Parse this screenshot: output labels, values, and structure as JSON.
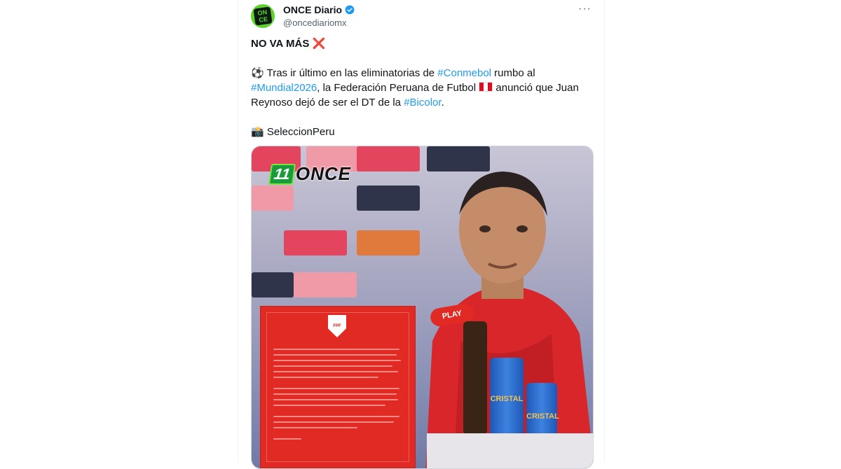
{
  "tweet": {
    "author": "ONCE Diario",
    "handle": "@oncediariomx",
    "avatar_text": "ON\nCE",
    "more_label": "···",
    "headline": "NO VA MÁS",
    "headline_emoji": "❌",
    "body_emoji": "⚽",
    "body_part1": "Tras ir último en las eliminatorias de ",
    "hashtag1": "#Conmebol",
    "body_part2": " rumbo al ",
    "hashtag2": "#Mundial2026",
    "body_part3": ", la Federación Peruana de Futbol ",
    "body_part4": " anunció que Juan Reynoso dejó de ser el DT de la ",
    "hashtag3": "#Bicolor",
    "body_part5": ".",
    "credit_emoji": "📸",
    "credit": "SeleccionPeru"
  },
  "media": {
    "logo_num": "11",
    "logo_word": "ONCE",
    "mic_label": "PLAY",
    "crest_label": "FPF",
    "can_label": "CRISTAL"
  },
  "colors": {
    "hashtag": "#1d9bf0",
    "verified": "#1d9bf0",
    "brand_green": "#5bd22e",
    "letter_red": "#e12a23"
  },
  "icons": {
    "verified": "verified-badge-icon",
    "more": "more-options-icon",
    "headline_emoji": "cross-mark-icon",
    "body_emoji": "soccer-ball-icon",
    "flag": "peru-flag-icon",
    "credit_emoji": "camera-icon"
  }
}
